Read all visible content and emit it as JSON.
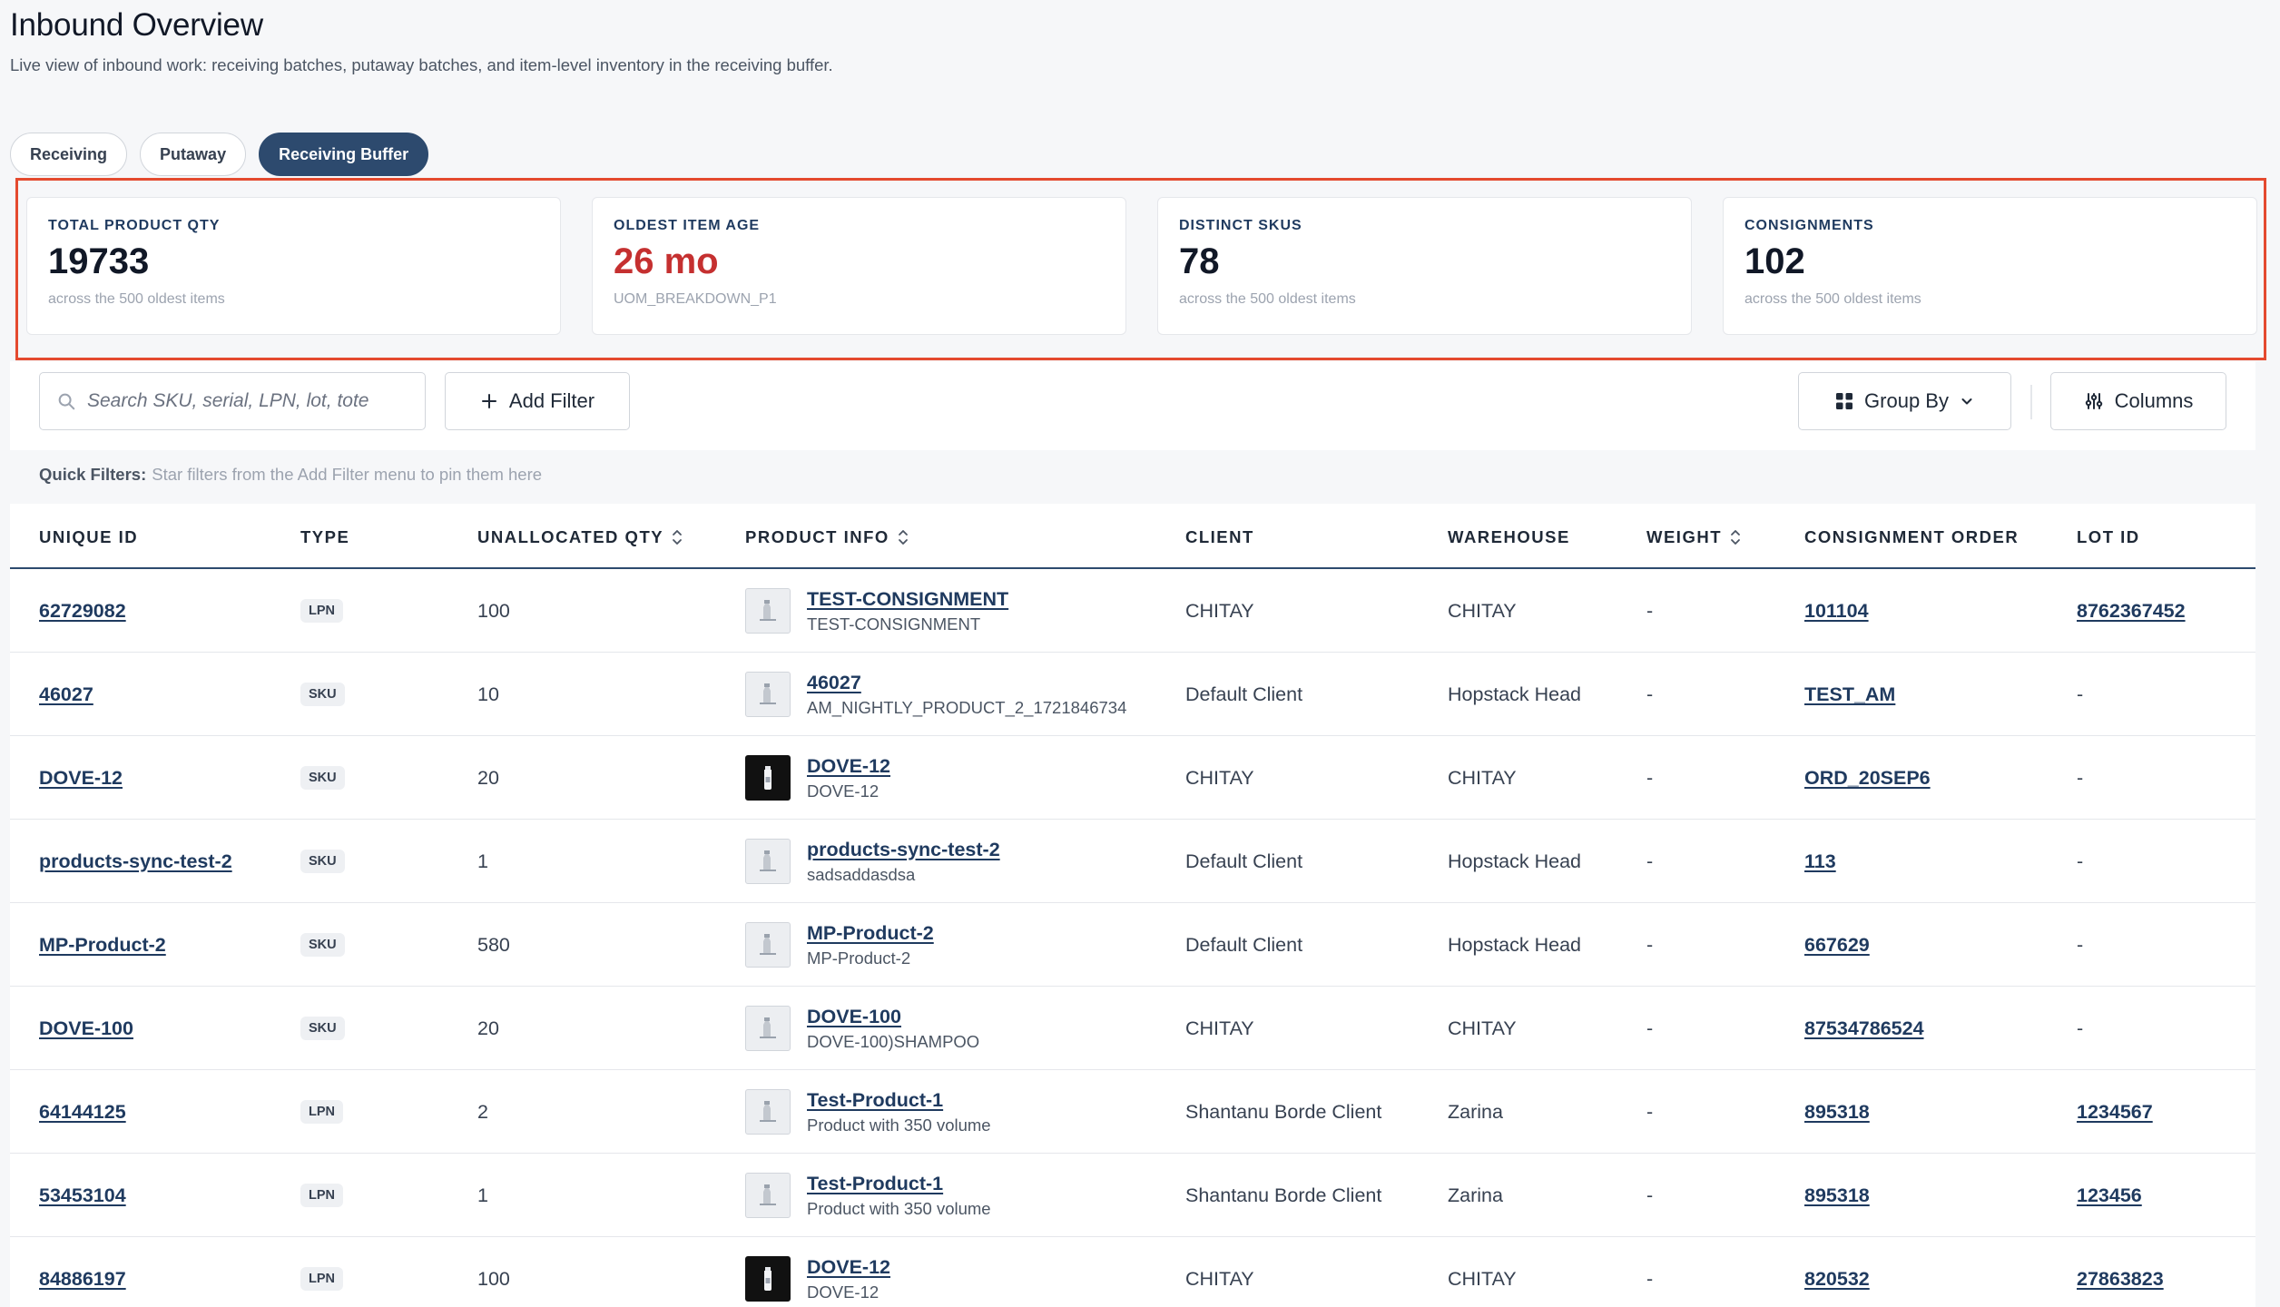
{
  "page": {
    "title": "Inbound Overview",
    "description": "Live view of inbound work: receiving batches, putaway batches, and item-level inventory in the receiving buffer."
  },
  "tabs": [
    {
      "label": "Receiving",
      "active": false
    },
    {
      "label": "Putaway",
      "active": false
    },
    {
      "label": "Receiving Buffer",
      "active": true
    }
  ],
  "kpis": [
    {
      "label": "TOTAL PRODUCT QTY",
      "value": "19733",
      "sub": "across the 500 oldest items"
    },
    {
      "label": "OLDEST ITEM AGE",
      "value": "26 mo",
      "sub": "UOM_BREAKDOWN_P1"
    },
    {
      "label": "DISTINCT SKUS",
      "value": "78",
      "sub": "across the 500 oldest items"
    },
    {
      "label": "CONSIGNMENTS",
      "value": "102",
      "sub": "across the 500 oldest items"
    }
  ],
  "toolbar": {
    "search_placeholder": "Search SKU, serial, LPN, lot, tote",
    "add_filter": "Add Filter",
    "group_by": "Group By",
    "columns": "Columns"
  },
  "quick_filters": {
    "label": "Quick Filters:",
    "hint": "Star filters from the Add Filter menu to pin them here"
  },
  "table": {
    "columns": [
      "UNIQUE ID",
      "TYPE",
      "UNALLOCATED QTY",
      "PRODUCT INFO",
      "CLIENT",
      "WAREHOUSE",
      "WEIGHT",
      "CONSIGNMENT ORDER",
      "LOT ID"
    ],
    "rows": [
      {
        "id": "62729082",
        "type": "LPN",
        "qty": "100",
        "product": "TEST-CONSIGNMENT",
        "product_sub": "TEST-CONSIGNMENT",
        "client": "CHITAY",
        "warehouse": "CHITAY",
        "weight": "-",
        "consignment": "101104",
        "lot": "8762367452"
      },
      {
        "id": "46027",
        "type": "SKU",
        "qty": "10",
        "product": "46027",
        "product_sub": "AM_NIGHTLY_PRODUCT_2_1721846734",
        "client": "Default Client",
        "warehouse": "Hopstack Head",
        "weight": "-",
        "consignment": "TEST_AM",
        "lot": "-"
      },
      {
        "id": "DOVE-12",
        "type": "SKU",
        "qty": "20",
        "product": "DOVE-12",
        "product_sub": "DOVE-12",
        "client": "CHITAY",
        "warehouse": "CHITAY",
        "weight": "-",
        "consignment": "ORD_20SEP6",
        "lot": "-"
      },
      {
        "id": "products-sync-test-2",
        "type": "SKU",
        "qty": "1",
        "product": "products-sync-test-2",
        "product_sub": "sadsaddasdsa",
        "client": "Default Client",
        "warehouse": "Hopstack Head",
        "weight": "-",
        "consignment": "113",
        "lot": "-"
      },
      {
        "id": "MP-Product-2",
        "type": "SKU",
        "qty": "580",
        "product": "MP-Product-2",
        "product_sub": "MP-Product-2",
        "client": "Default Client",
        "warehouse": "Hopstack Head",
        "weight": "-",
        "consignment": "667629",
        "lot": "-"
      },
      {
        "id": "DOVE-100",
        "type": "SKU",
        "qty": "20",
        "product": "DOVE-100",
        "product_sub": "DOVE-100)SHAMPOO",
        "client": "CHITAY",
        "warehouse": "CHITAY",
        "weight": "-",
        "consignment": "87534786524",
        "lot": "-"
      },
      {
        "id": "64144125",
        "type": "LPN",
        "qty": "2",
        "product": "Test-Product-1",
        "product_sub": "Product with 350 volume",
        "client": "Shantanu Borde Client",
        "warehouse": "Zarina",
        "weight": "-",
        "consignment": "895318",
        "lot": "1234567"
      },
      {
        "id": "53453104",
        "type": "LPN",
        "qty": "1",
        "product": "Test-Product-1",
        "product_sub": "Product with 350 volume",
        "client": "Shantanu Borde Client",
        "warehouse": "Zarina",
        "weight": "-",
        "consignment": "895318",
        "lot": "123456"
      },
      {
        "id": "84886197",
        "type": "LPN",
        "qty": "100",
        "product": "DOVE-12",
        "product_sub": "DOVE-12",
        "client": "CHITAY",
        "warehouse": "CHITAY",
        "weight": "-",
        "consignment": "820532",
        "lot": "27863823"
      }
    ]
  },
  "colors": {
    "accent": "#2d4a6e",
    "highlight_border": "#e44a2f",
    "alert_value": "#c53030"
  },
  "icons": {
    "search": "search-icon",
    "add": "plus-icon",
    "group": "grid-icon",
    "chevron": "chevron-down-icon",
    "columns": "sliders-icon",
    "sort": "sort-icon",
    "thumbnail_placeholder": "image-placeholder-icon",
    "thumbnail_dark": "bottle-icon"
  }
}
